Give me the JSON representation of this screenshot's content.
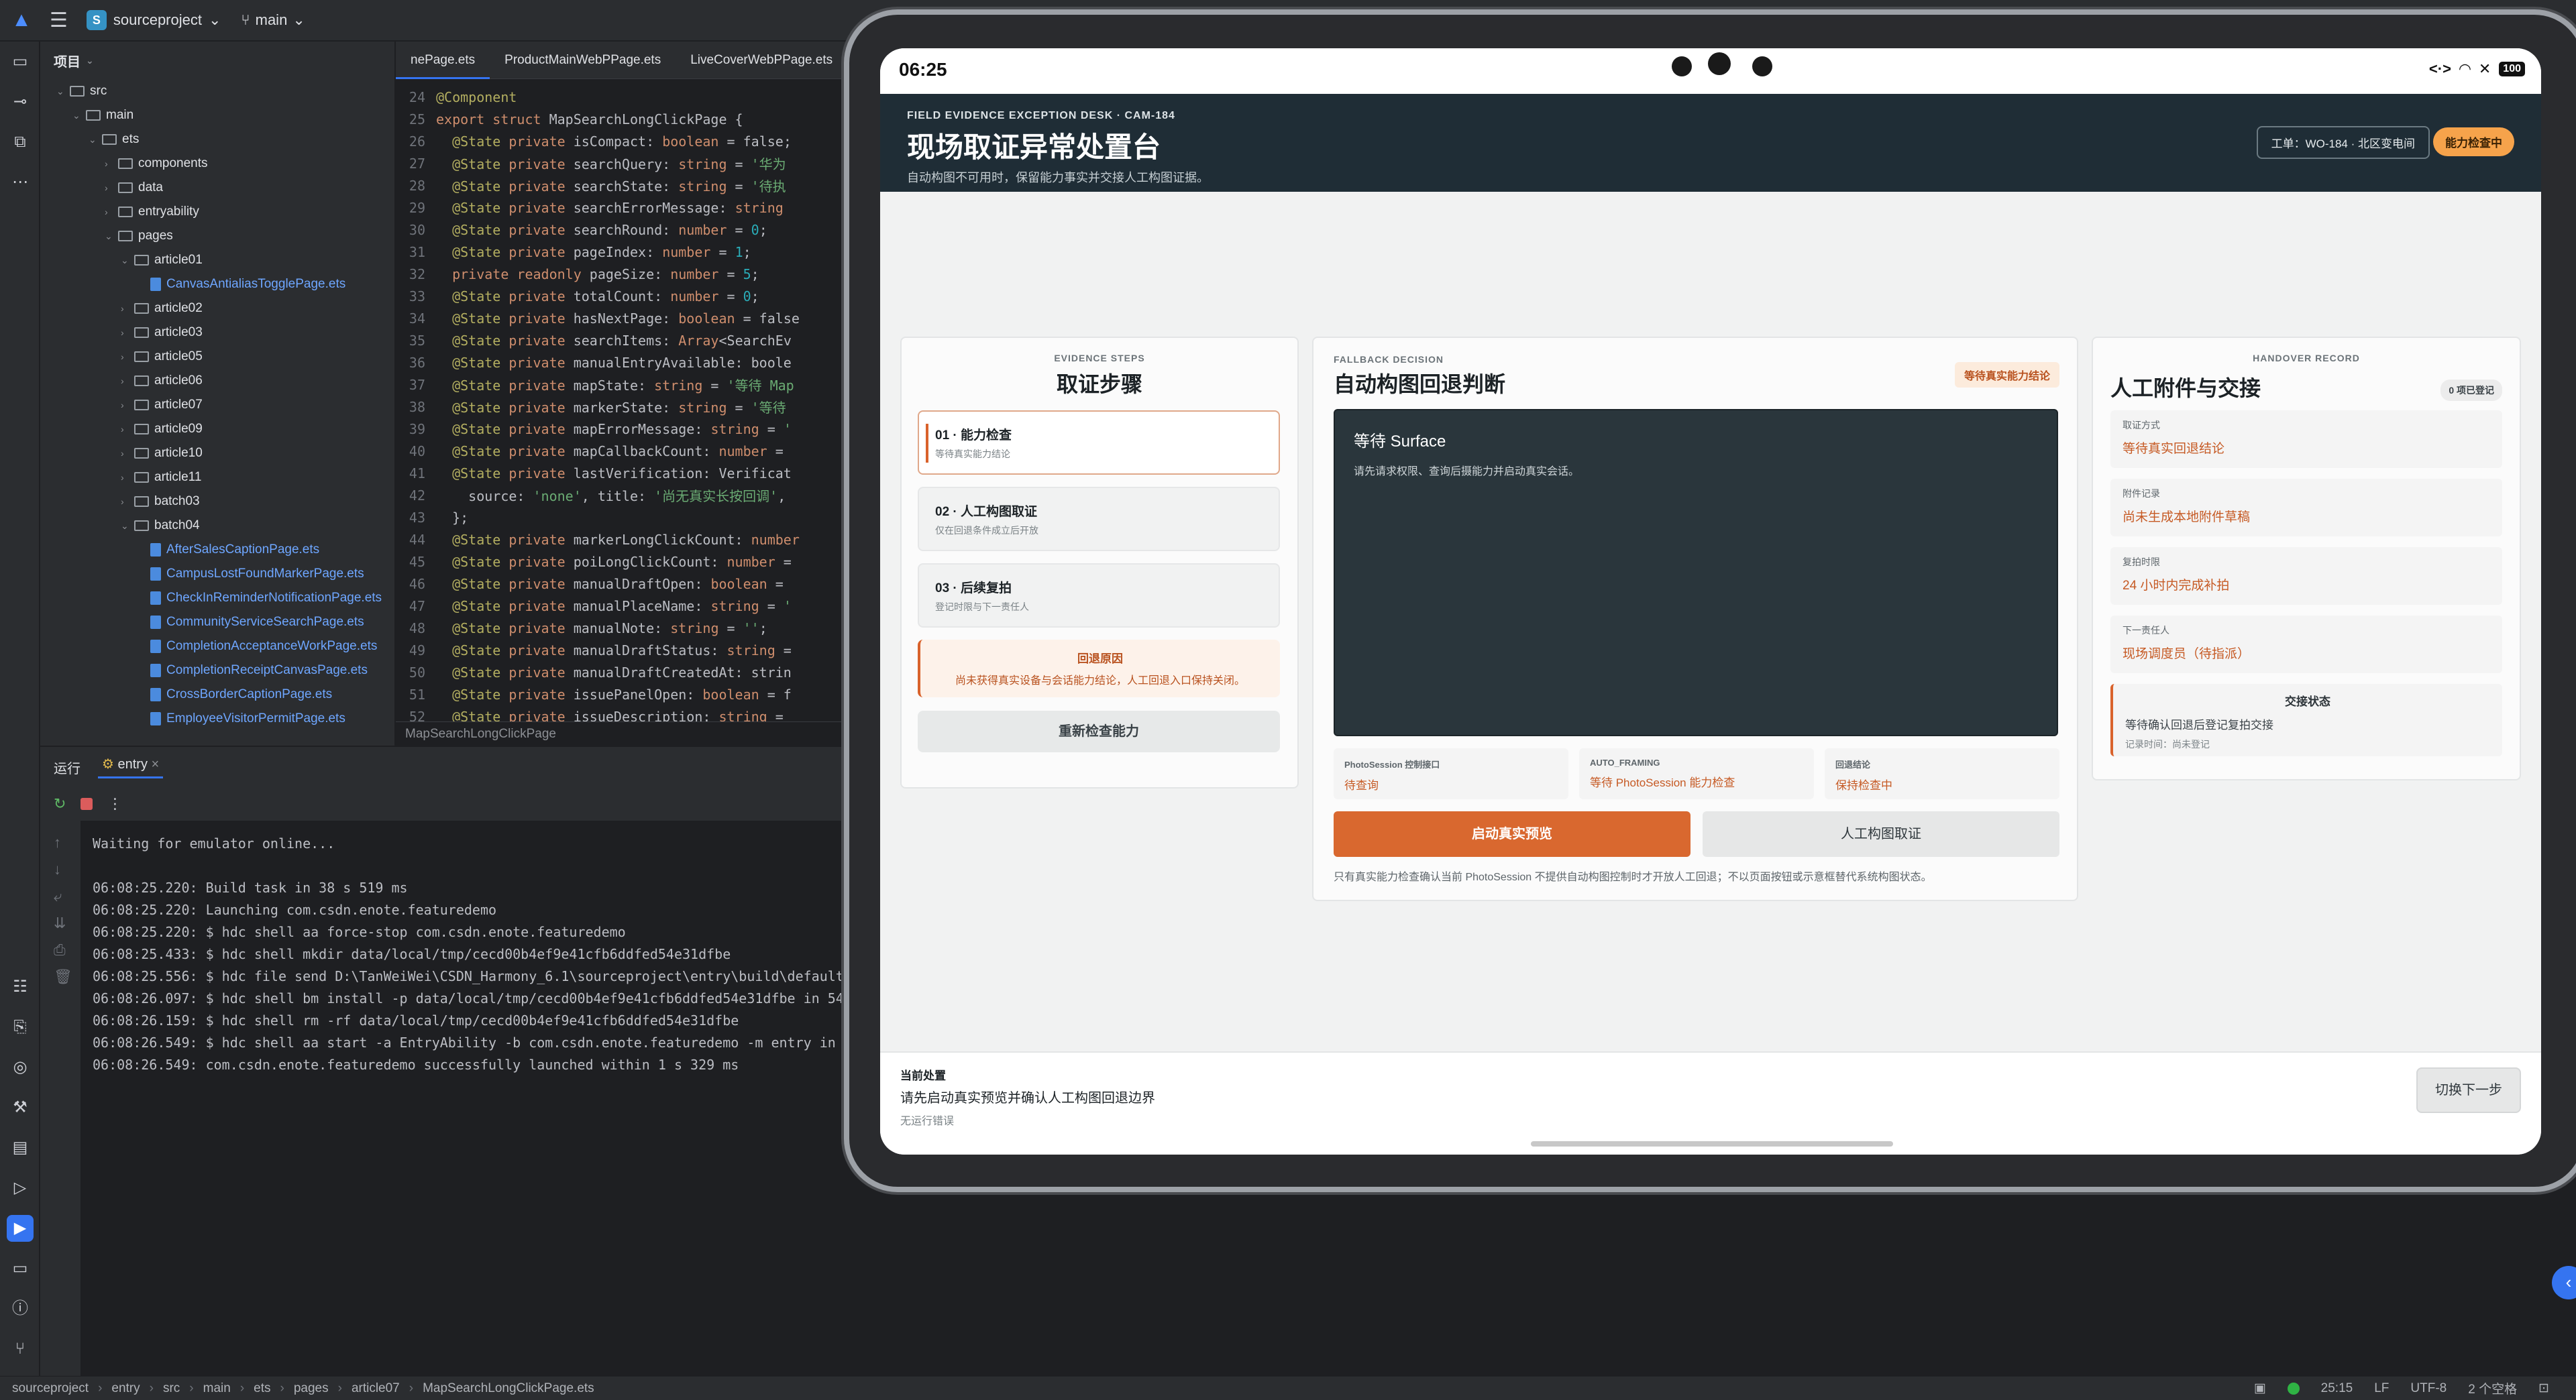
{
  "ide": {
    "project_name": "sourceproject",
    "project_badge": "S",
    "branch": "main",
    "project_panel_title": "项目",
    "tree": [
      {
        "label": "src",
        "type": "folder",
        "depth": 1,
        "open": true
      },
      {
        "label": "main",
        "type": "folder",
        "depth": 2,
        "open": true
      },
      {
        "label": "ets",
        "type": "folder",
        "depth": 3,
        "open": true
      },
      {
        "label": "components",
        "type": "folder",
        "depth": 4,
        "open": false
      },
      {
        "label": "data",
        "type": "folder",
        "depth": 4,
        "open": false
      },
      {
        "label": "entryability",
        "type": "folder",
        "depth": 4,
        "open": false
      },
      {
        "label": "pages",
        "type": "folder",
        "depth": 4,
        "open": true
      },
      {
        "label": "article01",
        "type": "folder",
        "depth": 5,
        "open": true
      },
      {
        "label": "CanvasAntialiasTogglePage.ets",
        "type": "file",
        "depth": 6
      },
      {
        "label": "article02",
        "type": "folder",
        "depth": 5,
        "open": false
      },
      {
        "label": "article03",
        "type": "folder",
        "depth": 5,
        "open": false
      },
      {
        "label": "article05",
        "type": "folder",
        "depth": 5,
        "open": false
      },
      {
        "label": "article06",
        "type": "folder",
        "depth": 5,
        "open": false
      },
      {
        "label": "article07",
        "type": "folder",
        "depth": 5,
        "open": false
      },
      {
        "label": "article09",
        "type": "folder",
        "depth": 5,
        "open": false
      },
      {
        "label": "article10",
        "type": "folder",
        "depth": 5,
        "open": false
      },
      {
        "label": "article11",
        "type": "folder",
        "depth": 5,
        "open": false
      },
      {
        "label": "batch03",
        "type": "folder",
        "depth": 5,
        "open": false
      },
      {
        "label": "batch04",
        "type": "folder",
        "depth": 5,
        "open": true
      },
      {
        "label": "AfterSalesCaptionPage.ets",
        "type": "file",
        "depth": 6
      },
      {
        "label": "CampusLostFoundMarkerPage.ets",
        "type": "file",
        "depth": 6
      },
      {
        "label": "CheckInReminderNotificationPage.ets",
        "type": "file",
        "depth": 6
      },
      {
        "label": "CommunityServiceSearchPage.ets",
        "type": "file",
        "depth": 6
      },
      {
        "label": "CompletionAcceptanceWorkPage.ets",
        "type": "file",
        "depth": 6
      },
      {
        "label": "CompletionReceiptCanvasPage.ets",
        "type": "file",
        "depth": 6
      },
      {
        "label": "CrossBorderCaptionPage.ets",
        "type": "file",
        "depth": 6
      },
      {
        "label": "EmployeeVisitorPermitPage.ets",
        "type": "file",
        "depth": 6
      }
    ],
    "editor_tabs": [
      "nePage.ets",
      "ProductMainWebPPage.ets",
      "LiveCoverWebPPage.ets"
    ],
    "code_lines": [
      {
        "n": "24",
        "t": "@Component"
      },
      {
        "n": "25",
        "t": "export struct MapSearchLongClickPage {"
      },
      {
        "n": "26",
        "t": "  @State private isCompact: boolean = false;"
      },
      {
        "n": "27",
        "t": "  @State private searchQuery: string = '华为"
      },
      {
        "n": "28",
        "t": "  @State private searchState: string = '待执"
      },
      {
        "n": "29",
        "t": "  @State private searchErrorMessage: string"
      },
      {
        "n": "30",
        "t": "  @State private searchRound: number = 0;"
      },
      {
        "n": "31",
        "t": "  @State private pageIndex: number = 1;"
      },
      {
        "n": "32",
        "t": "  private readonly pageSize: number = 5;"
      },
      {
        "n": "33",
        "t": "  @State private totalCount: number = 0;"
      },
      {
        "n": "34",
        "t": "  @State private hasNextPage: boolean = false"
      },
      {
        "n": "35",
        "t": "  @State private searchItems: Array<SearchEv"
      },
      {
        "n": "36",
        "t": "  @State private manualEntryAvailable: boole"
      },
      {
        "n": "37",
        "t": "  @State private mapState: string = '等待 Map"
      },
      {
        "n": "38",
        "t": "  @State private markerState: string = '等待"
      },
      {
        "n": "39",
        "t": "  @State private mapErrorMessage: string = '"
      },
      {
        "n": "40",
        "t": "  @State private mapCallbackCount: number ="
      },
      {
        "n": "41",
        "t": "  @State private lastVerification: Verificat"
      },
      {
        "n": "42",
        "t": "    source: 'none', title: '尚无真实长按回调',"
      },
      {
        "n": "43",
        "t": "  };"
      },
      {
        "n": "44",
        "t": "  @State private markerLongClickCount: number"
      },
      {
        "n": "45",
        "t": "  @State private poiLongClickCount: number ="
      },
      {
        "n": "46",
        "t": "  @State private manualDraftOpen: boolean ="
      },
      {
        "n": "47",
        "t": "  @State private manualPlaceName: string = '"
      },
      {
        "n": "48",
        "t": "  @State private manualNote: string = '';"
      },
      {
        "n": "49",
        "t": "  @State private manualDraftStatus: string ="
      },
      {
        "n": "50",
        "t": "  @State private manualDraftCreatedAt: strin"
      },
      {
        "n": "51",
        "t": "  @State private issuePanelOpen: boolean = f"
      },
      {
        "n": "52",
        "t": "  @State private issueDescription: string ="
      }
    ],
    "editor_footer": "MapSearchLongClickPage",
    "run_tab_label": "运行",
    "run_config": "entry",
    "console_lines": [
      "Waiting for emulator online...",
      "",
      "06:08:25.220: Build task in 38 s 519 ms",
      "06:08:25.220: Launching com.csdn.enote.featuredemo",
      "06:08:25.220: $ hdc shell aa force-stop com.csdn.enote.featuredemo",
      "06:08:25.433: $ hdc shell mkdir data/local/tmp/cecd00b4ef9e41cfb6ddfed54e31dfbe",
      "06:08:25.556: $ hdc file send D:\\TanWeiWei\\CSDN_Harmony_6.1\\sourceproject\\entry\\build\\default",
      "06:08:26.097: $ hdc shell bm install -p data/local/tmp/cecd00b4ef9e41cfb6ddfed54e31dfbe in 54",
      "06:08:26.159: $ hdc shell rm -rf data/local/tmp/cecd00b4ef9e41cfb6ddfed54e31dfbe",
      "06:08:26.549: $ hdc shell aa start -a EntryAbility -b com.csdn.enote.featuredemo -m entry in",
      "06:08:26.549: com.csdn.enote.featuredemo successfully launched within 1 s 329 ms"
    ],
    "status_crumbs": [
      "sourceproject",
      "entry",
      "src",
      "main",
      "ets",
      "pages",
      "article07",
      "MapSearchLongClickPage.ets"
    ],
    "status_right": {
      "position": "25:15",
      "line_sep": "LF",
      "encoding": "UTF-8",
      "indent": "2 个空格"
    }
  },
  "device": {
    "time": "06:25",
    "battery": "100",
    "hero": {
      "kicker": "FIELD EVIDENCE EXCEPTION DESK · CAM-184",
      "title": "现场取证异常处置台",
      "subtitle": "自动构图不可用时，保留能力事实并交接人工构图证据。",
      "ticket": "工单：WO-184 · 北区变电间",
      "status_pill": "能力检查中"
    },
    "steps_card": {
      "eyebrow": "EVIDENCE STEPS",
      "title": "取证步骤",
      "steps": [
        {
          "title": "01 · 能力检查",
          "sub": "等待真实能力结论"
        },
        {
          "title": "02 · 人工构图取证",
          "sub": "仅在回退条件成立后开放"
        },
        {
          "title": "03 · 后续复拍",
          "sub": "登记时限与下一责任人"
        }
      ],
      "reason_title": "回退原因",
      "reason_text": "尚未获得真实设备与会话能力结论，人工回退入口保持关闭。",
      "recheck_label": "重新检查能力"
    },
    "decision_card": {
      "eyebrow": "FALLBACK DECISION",
      "title": "自动构图回退判断",
      "tag": "等待真实能力结论",
      "surface_title": "等待 Surface",
      "surface_text": "请先请求权限、查询后摄能力并启动真实会话。",
      "metrics": [
        {
          "k": "PhotoSession 控制接口",
          "v": "待查询"
        },
        {
          "k": "AUTO_FRAMING",
          "v": "等待 PhotoSession 能力检查"
        },
        {
          "k": "回退结论",
          "v": "保持检查中"
        }
      ],
      "primary_label": "启动真实预览",
      "secondary_label": "人工构图取证",
      "note": "只有真实能力检查确认当前 PhotoSession 不提供自动构图控制时才开放人工回退；不以页面按钮或示意框替代系统构图状态。"
    },
    "handover_card": {
      "eyebrow": "HANDOVER RECORD",
      "title": "人工附件与交接",
      "count": "0 项已登记",
      "rows": [
        {
          "k": "取证方式",
          "v": "等待真实回退结论"
        },
        {
          "k": "附件记录",
          "v": "尚未生成本地附件草稿"
        },
        {
          "k": "复拍时限",
          "v": "24 小时内完成补拍"
        },
        {
          "k": "下一责任人",
          "v": "现场调度员（待指派）"
        }
      ],
      "state_title": "交接状态",
      "state_text": "等待确认回退后登记复拍交接",
      "state_time": "记录时间：尚未登记"
    },
    "footer": {
      "label": "当前处置",
      "value": "请先启动真实预览并确认人工构图回退边界",
      "error": "无运行错误",
      "next_label": "切换下一步"
    }
  }
}
